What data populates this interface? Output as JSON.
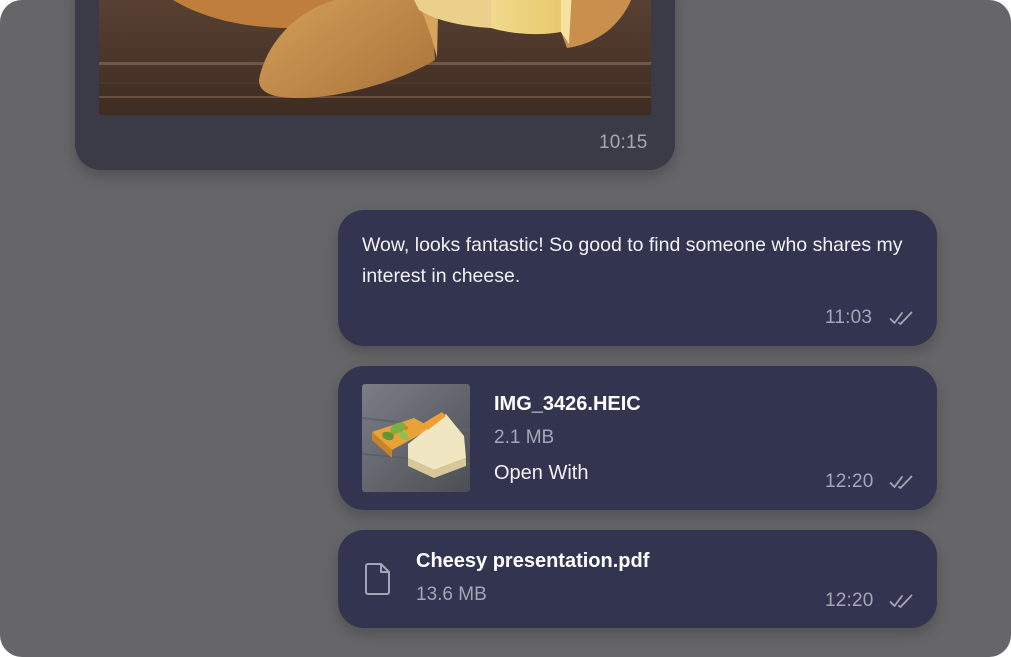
{
  "messages": {
    "incoming_image": {
      "time": "10:15"
    },
    "text_message": {
      "text": "Wow, looks fantastic! So good to find someone who shares my interest in cheese.",
      "time": "11:03"
    },
    "image_file": {
      "file_name": "IMG_3426.HEIC",
      "file_size": "2.1 MB",
      "action_label": "Open With",
      "time": "12:20"
    },
    "pdf_file": {
      "file_name": "Cheesy presentation.pdf",
      "file_size": "13.6 MB",
      "time": "12:20"
    }
  },
  "colors": {
    "background": "#666669",
    "incoming_bubble": "#3b3b48",
    "outgoing_bubble": "#333450",
    "secondary_text": "#a6a6b4"
  },
  "icons": {
    "read_receipt": "double-check-icon",
    "document": "document-icon"
  }
}
